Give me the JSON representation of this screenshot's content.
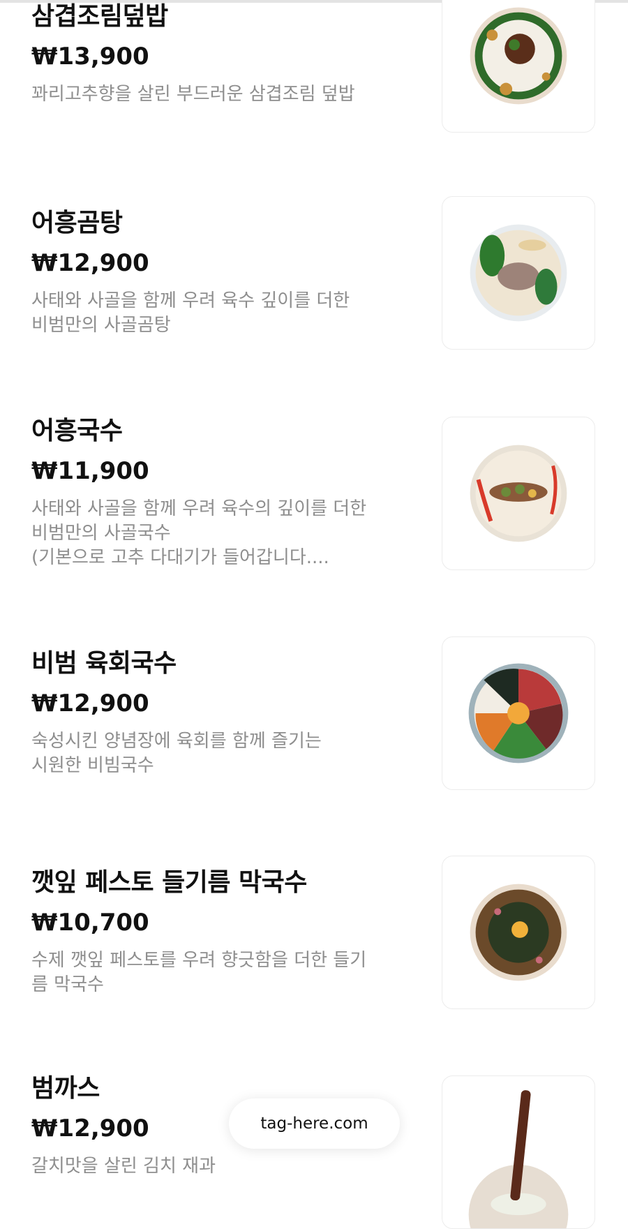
{
  "menu": {
    "items": [
      {
        "name": "삼겹조림덮밥",
        "price": "₩13,900",
        "description": "꽈리고추향을  살린 부드러운  삼겹조림 덮밥"
      },
      {
        "name": "어흥곰탕",
        "price": "₩12,900",
        "description": "사태와 사골을 함께 우려 육수 깊이를 더한\n비범만의 사골곰탕"
      },
      {
        "name": "어흥국수",
        "price": "₩11,900",
        "description": "사태와 사골을 함께 우려 육수의 깊이를 더한\n비범만의 사골국수\n(기본으로 고추 다대기가 들어갑니다...."
      },
      {
        "name": "비범 육회국수",
        "price": "₩12,900",
        "description": "숙성시킨 양념장에 육회를 함께 즐기는\n시원한 비빔국수"
      },
      {
        "name": "깻잎 페스토 들기름 막국수",
        "price": "₩10,700",
        "description": "수제 깻잎 페스토를 우려 향긋함을 더한 들기\n름 막국수"
      },
      {
        "name": "범까스",
        "price": "₩12,900",
        "description": "갈치맛을 살린 김치 재과"
      }
    ]
  },
  "footer": {
    "site": "tag-here.com"
  }
}
